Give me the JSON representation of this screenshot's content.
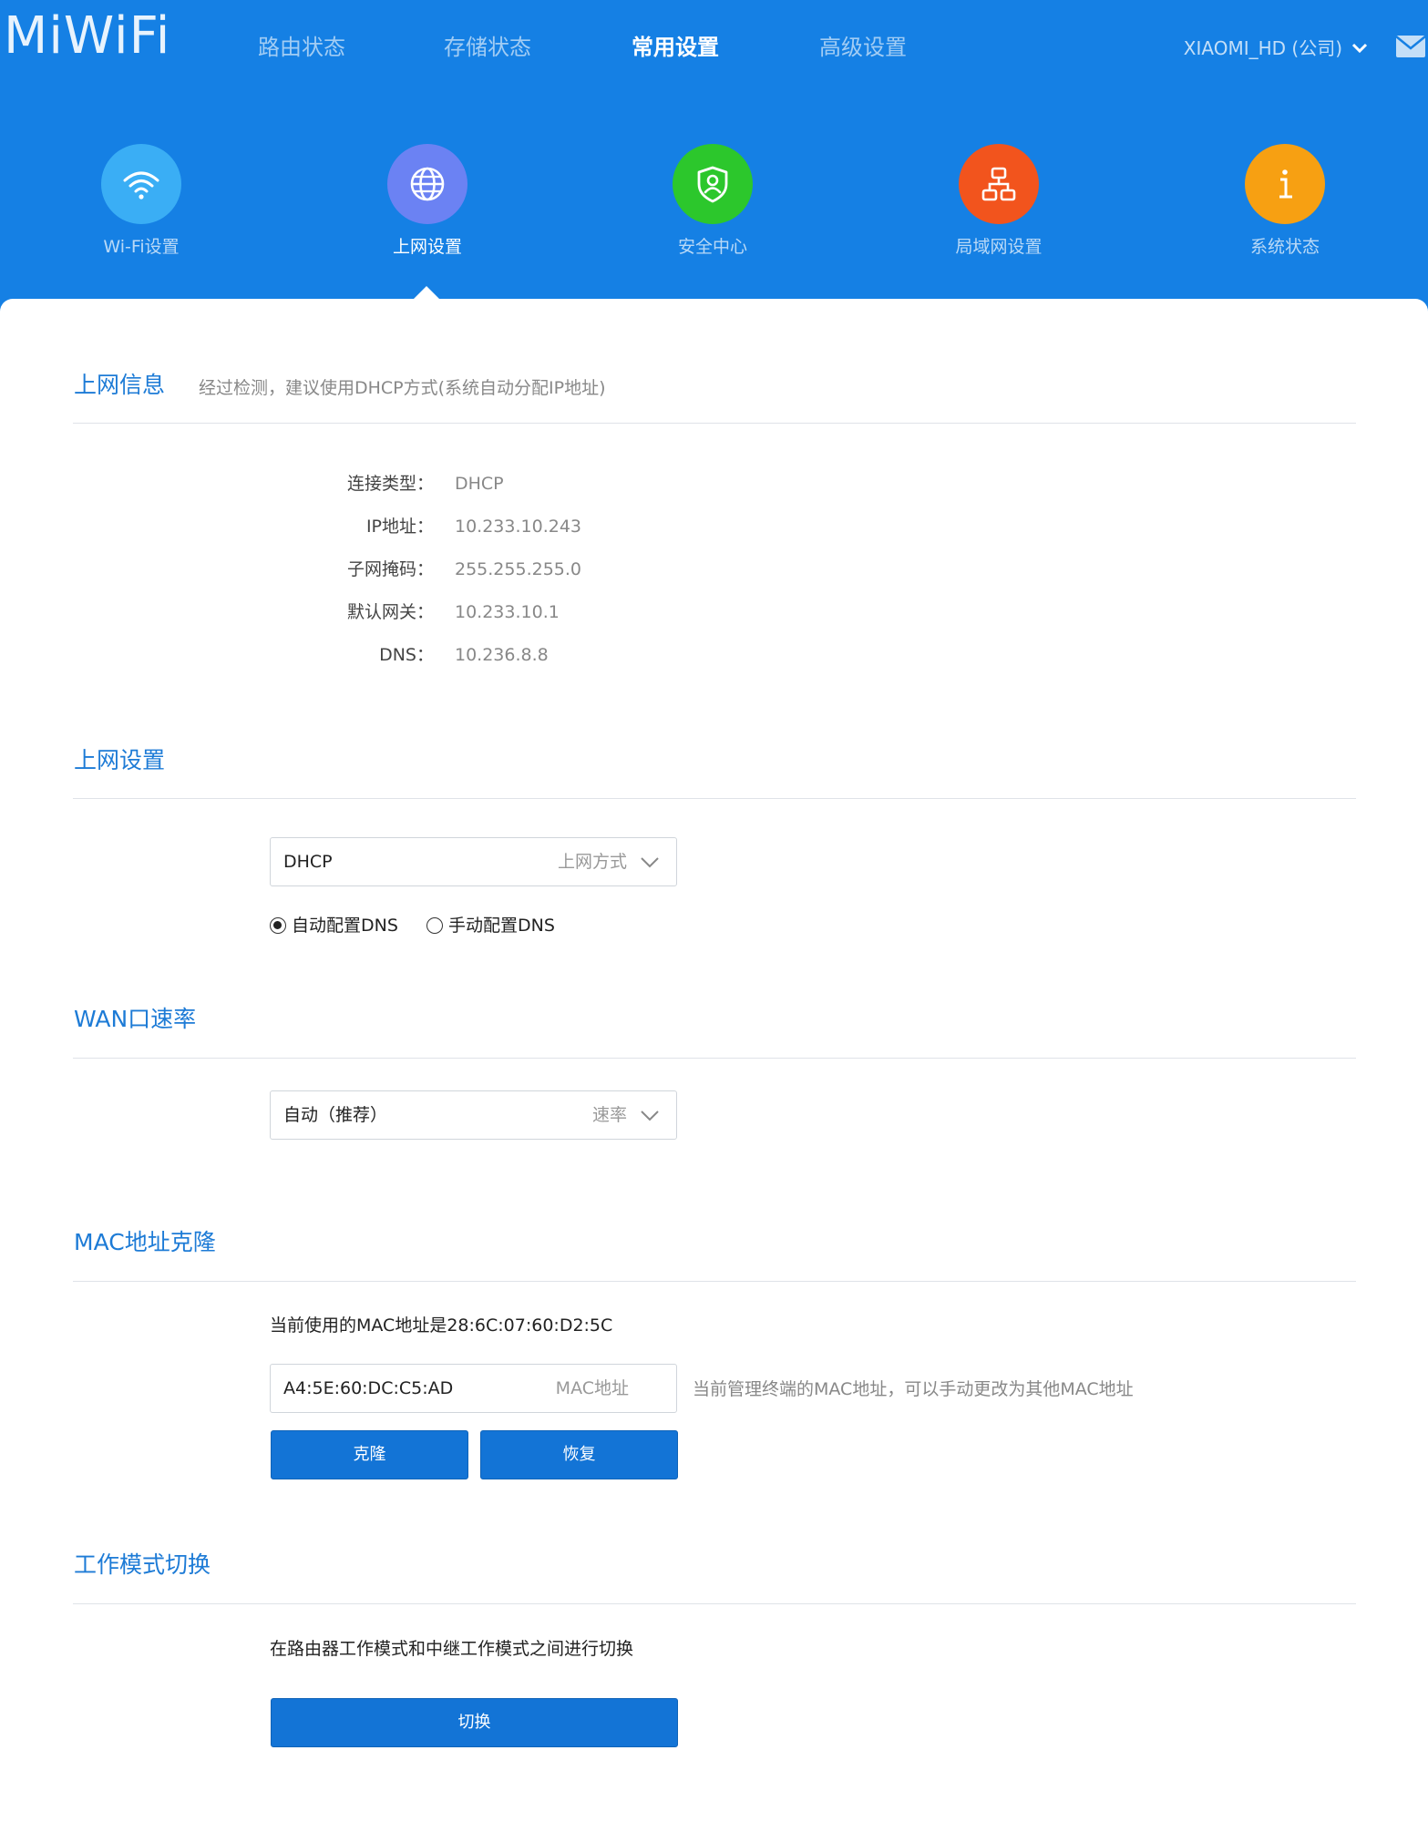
{
  "app": {
    "logo": "MiWiFi",
    "account": "XIAOMI_HD (公司)"
  },
  "nav": {
    "items": [
      "路由状态",
      "存储状态",
      "常用设置",
      "高级设置"
    ],
    "active": "常用设置"
  },
  "categories": [
    {
      "label": "Wi-Fi设置",
      "icon": "wifi-icon",
      "color": "#3aaef5"
    },
    {
      "label": "上网设置",
      "icon": "globe-icon",
      "color": "#6b82f3"
    },
    {
      "label": "安全中心",
      "icon": "shield-icon",
      "color": "#2cc72c"
    },
    {
      "label": "局域网设置",
      "icon": "network-icon",
      "color": "#f2541d"
    },
    {
      "label": "系统状态",
      "icon": "info-icon",
      "color": "#f7a012"
    }
  ],
  "internet_info": {
    "title": "上网信息",
    "hint": "经过检测，建议使用DHCP方式(系统自动分配IP地址)",
    "rows": [
      {
        "label": "连接类型：",
        "value": "DHCP"
      },
      {
        "label": "IP地址：",
        "value": "10.233.10.243"
      },
      {
        "label": "子网掩码：",
        "value": "255.255.255.0"
      },
      {
        "label": "默认网关：",
        "value": "10.233.10.1"
      },
      {
        "label": "DNS：",
        "value": "10.236.8.8"
      }
    ]
  },
  "internet_settings": {
    "title": "上网设置",
    "mode_value": "DHCP",
    "mode_placeholder": "上网方式",
    "dns_auto_label": "自动配置DNS",
    "dns_manual_label": "手动配置DNS",
    "dns_selected": "auto"
  },
  "wan_speed": {
    "title": "WAN口速率",
    "value": "自动（推荐）",
    "placeholder": "速率"
  },
  "mac_clone": {
    "title": "MAC地址克隆",
    "current_text": "当前使用的MAC地址是28:6C:07:60:D2:5C",
    "input_value": "A4:5E:60:DC:C5:AD",
    "input_placeholder": "MAC地址",
    "input_hint": "当前管理终端的MAC地址，可以手动更改为其他MAC地址",
    "clone_label": "克隆",
    "restore_label": "恢复"
  },
  "work_mode": {
    "title": "工作模式切换",
    "description": "在路由器工作模式和中继工作模式之间进行切换",
    "switch_label": "切换"
  },
  "colors": {
    "header_bg": "#1580e4",
    "accent": "#1d7bd6",
    "button": "#1374d6"
  }
}
